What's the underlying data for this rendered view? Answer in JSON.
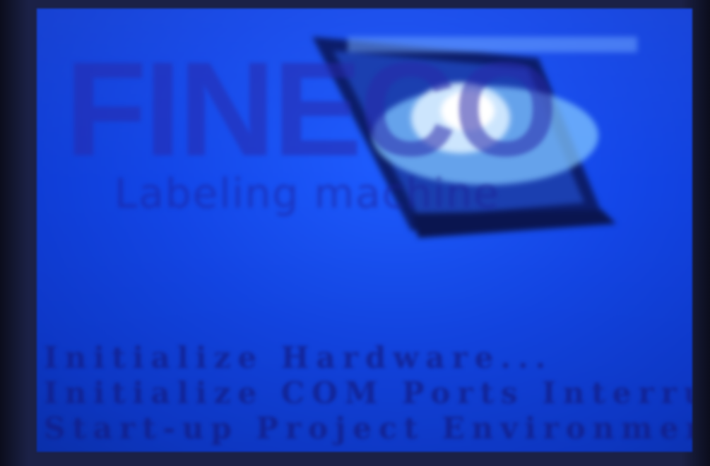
{
  "splash": {
    "brand": "FINECO",
    "subtitle": "Labeling machine"
  },
  "boot_log": [
    "Initialize Hardware...",
    "Initialize COM Ports Interrupti",
    "Start-up Project Environment..."
  ],
  "icons": {
    "monitor": "monitor-globe-icon"
  },
  "colors": {
    "screen_background": "#1346e8",
    "brand_text": "#2828aa",
    "boot_text": "#141e8c"
  }
}
